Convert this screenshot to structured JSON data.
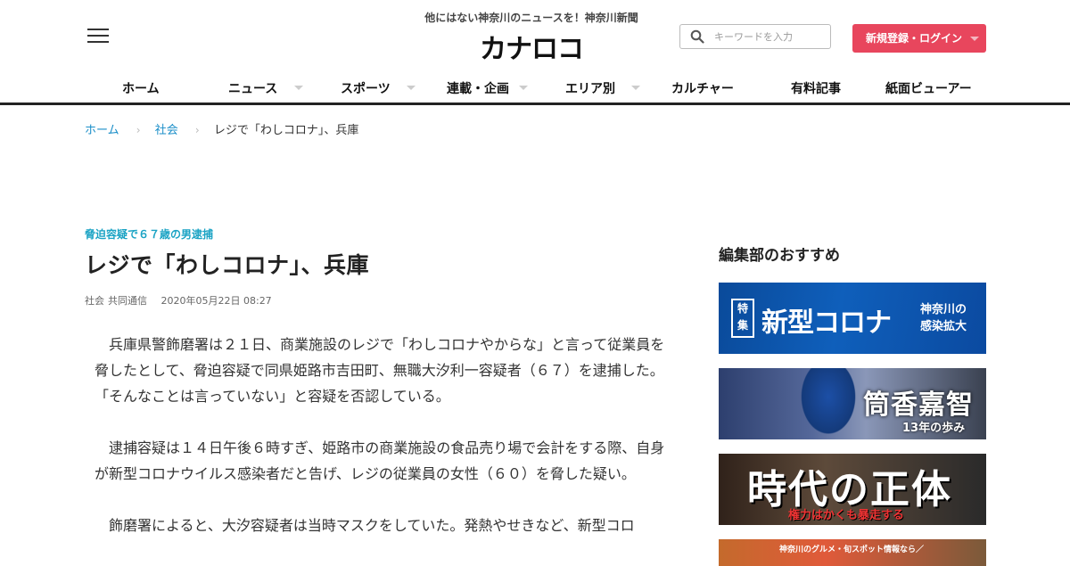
{
  "header": {
    "tagline": "他にはない神奈川のニュースを！神奈川新聞",
    "logo": "カナロコ",
    "search_placeholder": "キーワードを入力",
    "login_label": "新規登録・ログイン"
  },
  "nav": {
    "items": [
      {
        "label": "ホーム",
        "has_dropdown": false
      },
      {
        "label": "ニュース",
        "has_dropdown": true
      },
      {
        "label": "スポーツ",
        "has_dropdown": true
      },
      {
        "label": "連載・企画",
        "has_dropdown": true
      },
      {
        "label": "エリア別",
        "has_dropdown": true
      },
      {
        "label": "カルチャー",
        "has_dropdown": false
      },
      {
        "label": "有料記事",
        "has_dropdown": false
      },
      {
        "label": "紙面ビューアー",
        "has_dropdown": false
      }
    ]
  },
  "breadcrumb": {
    "home": "ホーム",
    "category": "社会",
    "current": "レジで「わしコロナ」、兵庫"
  },
  "article": {
    "subheadline": "脅迫容疑で６７歳の男逮捕",
    "headline": "レジで「わしコロナ」、兵庫",
    "category": "社会",
    "source": "共同通信",
    "datetime": "2020年05月22日 08:27",
    "paragraphs": [
      "兵庫県警飾磨署は２１日、商業施設のレジで「わしコロナやからな」と言って従業員を脅したとして、脅迫容疑で同県姫路市吉田町、無職大汐利一容疑者（６７）を逮捕した。「そんなことは言っていない」と容疑を否認している。",
      "逮捕容疑は１４日午後６時すぎ、姫路市の商業施設の食品売り場で会計をする際、自身が新型コロナウイルス感染者だと告げ、レジの従業員の女性（６０）を脅した疑い。",
      "飾磨署によると、大汐容疑者は当時マスクをしていた。発熱やせきなど、新型コロ"
    ]
  },
  "sidebar": {
    "title": "編集部のおすすめ",
    "banners": [
      {
        "badge": "特集",
        "main": "新型コロナ",
        "sub_line1": "神奈川の",
        "sub_line2": "感染拡大"
      },
      {
        "main": "筒香嘉智",
        "sub": "13年の歩み"
      },
      {
        "main": "時代の正体",
        "sub": "権力はかくも暴走する"
      },
      {
        "sub": "神奈川のグルメ・旬スポット情報なら／"
      }
    ]
  },
  "colors": {
    "accent_link": "#1a8ec8",
    "subheadline": "#1aa3c4",
    "login_button": "#e8465d"
  }
}
